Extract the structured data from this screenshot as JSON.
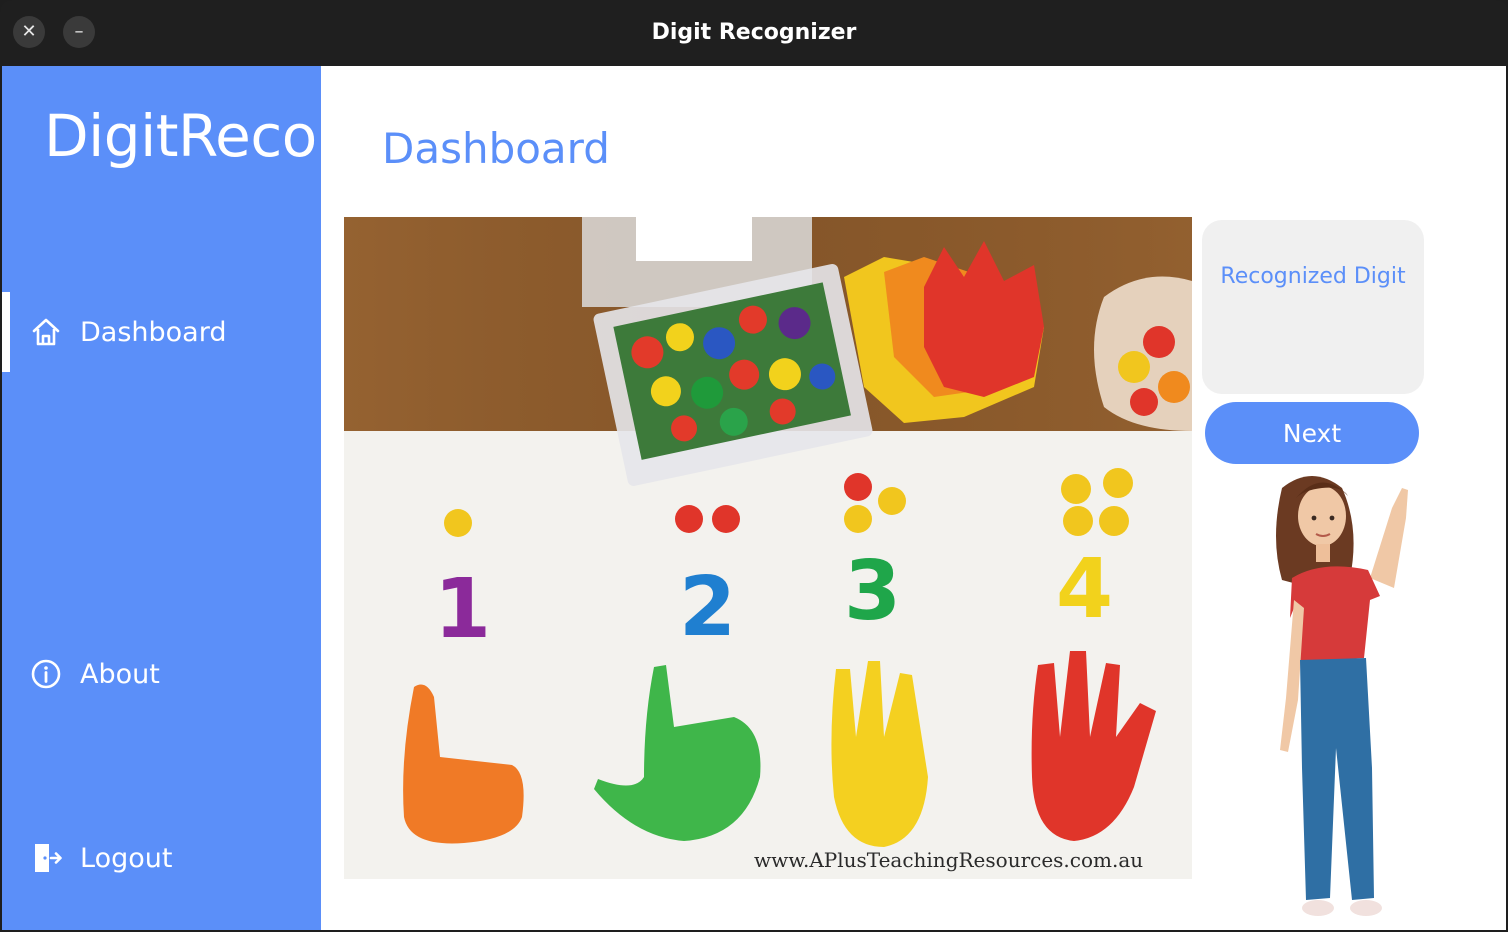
{
  "window": {
    "title": "Digit Recognizer"
  },
  "sidebar": {
    "brand": "DigitReco",
    "items": [
      {
        "label": "Dashboard",
        "icon": "home-icon",
        "active": true
      },
      {
        "label": "About",
        "icon": "info-icon",
        "active": false
      },
      {
        "label": "Logout",
        "icon": "logout-icon",
        "active": false
      }
    ]
  },
  "main": {
    "title": "Dashboard",
    "image": {
      "watermark": "www.APlusTeachingResources.com.au",
      "digits": [
        "1",
        "2",
        "3",
        "4"
      ]
    },
    "result": {
      "label": "Recognized Digit"
    },
    "next_button": "Next"
  },
  "colors": {
    "accent": "#5b8ff9",
    "titlebar": "#1f1f1f",
    "panel": "#f0f0f0"
  }
}
